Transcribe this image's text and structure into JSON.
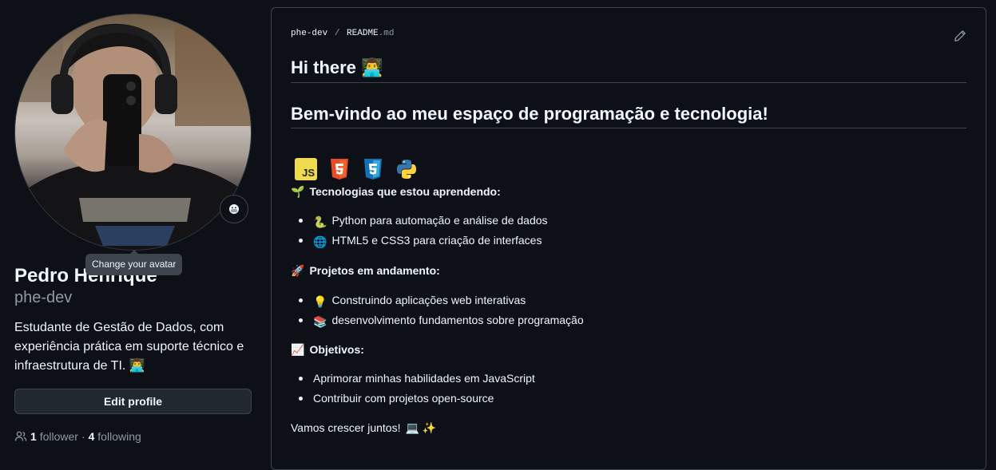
{
  "profile": {
    "avatar_tooltip": "Change your avatar",
    "status_icon": "masked-face-icon",
    "name": "Pedro Henrique",
    "login": "phe-dev",
    "bio": "Estudante de Gestão de Dados, com experiência prática em suporte técnico e infraestrutura de TI. 👨‍💻",
    "edit_label": "Edit profile",
    "followers_count": "1",
    "followers_label": "follower",
    "separator": "·",
    "following_count": "4",
    "following_label": "following"
  },
  "readme": {
    "owner": "phe-dev",
    "separator": "/",
    "file_name": "README",
    "file_ext": ".md",
    "heading1": "Hi there 👨‍💻",
    "heading2": "Bem-vindo ao meu espaço de programação e tecnologia!",
    "badges": [
      {
        "name": "JS",
        "icon": "javascript-logo-icon"
      },
      {
        "name": "HTML5",
        "icon": "html5-logo-icon"
      },
      {
        "name": "CSS3",
        "icon": "css3-logo-icon"
      },
      {
        "name": "Python",
        "icon": "python-logo-icon"
      }
    ],
    "sections": [
      {
        "emoji": "🌱",
        "title": "Tecnologias que estou aprendendo:",
        "items": [
          {
            "emoji": "🐍",
            "text": "Python para automação e análise de dados"
          },
          {
            "emoji": "🌐",
            "text": "HTML5 e CSS3 para criação de interfaces"
          }
        ]
      },
      {
        "emoji": "🚀",
        "title": "Projetos em andamento:",
        "items": [
          {
            "emoji": "💡",
            "text": "Construindo aplicações web interativas"
          },
          {
            "emoji": "📚",
            "text": "desenvolvimento fundamentos sobre programação"
          }
        ]
      },
      {
        "emoji": "📈",
        "title": "Objetivos:",
        "items": [
          {
            "emoji": "",
            "text": "Aprimorar minhas habilidades em JavaScript"
          },
          {
            "emoji": "",
            "text": "Contribuir com projetos open-source"
          }
        ]
      }
    ],
    "closing_text": "Vamos crescer juntos!",
    "closing_emojis": "💻 ✨"
  },
  "colors": {
    "background": "#0d1117",
    "border": "#3d444d",
    "text": "#f0f6fc",
    "muted": "#9198a1",
    "button_bg": "#212830"
  }
}
